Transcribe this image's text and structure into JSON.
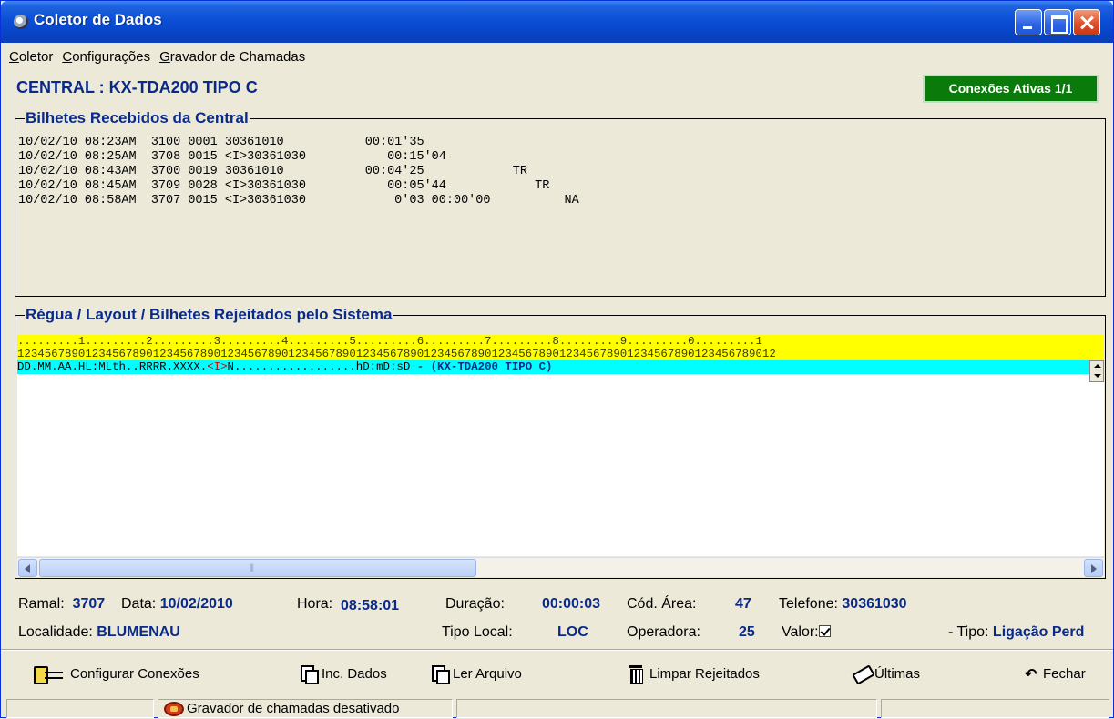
{
  "window": {
    "title": "Coletor de Dados"
  },
  "menu": [
    {
      "accel": "C",
      "rest": "oletor"
    },
    {
      "accel": "C",
      "rest": "onfigurações"
    },
    {
      "accel": "G",
      "rest": "ravador de Chamadas"
    }
  ],
  "central": {
    "label": "CENTRAL : KX-TDA200 TIPO C"
  },
  "connections_badge": "Conexões Ativas 1/1",
  "received": {
    "title": "Bilhetes Recebidos da Central",
    "lines": [
      "10/02/10 08:23AM  3100 0001 30361010           00:01'35",
      "10/02/10 08:25AM  3708 0015 <I>30361030           00:15'04",
      "10/02/10 08:43AM  3700 0019 30361010           00:04'25            TR",
      "10/02/10 08:45AM  3709 0028 <I>30361030           00:05'44            TR",
      "10/02/10 08:58AM  3707 0015 <I>30361030            0'03 00:00'00          NA"
    ]
  },
  "ruler": {
    "title": "Régua / Layout / Bilhetes Rejeitados pelo Sistema",
    "line1": ".........1.........2.........3.........4.........5.........6.........7.........8.........9.........0.........1",
    "line2": "1234567890123456789012345678901234567890123456789012345678901234567890123456789012345678901234567890123456789012",
    "layout_a": "DD.MM.AA.HL:MLth..RRRR.XXXX.",
    "layout_red": "<I>",
    "layout_b": "N..................hD:mD:sD - ",
    "layout_blue": "(KX-TDA200 TIPO C)"
  },
  "details": {
    "ramal_label": "Ramal:",
    "ramal": "3707",
    "data_label": "Data:",
    "data": "10/02/2010",
    "hora_label": "Hora:",
    "hora": "08:58:01",
    "duracao_label": "Duração:",
    "duracao": "00:00:03",
    "area_label": "Cód. Área:",
    "area": "47",
    "telefone_label": "Telefone:",
    "telefone": "30361030",
    "localidade_label": "Localidade:",
    "localidade": "BLUMENAU",
    "tipo_local_label": "Tipo Local:",
    "tipo_local": "LOC",
    "operadora_label": "Operadora:",
    "operadora": "25",
    "valor_label": "Valor:",
    "tipo_label": "- Tipo:",
    "tipo": "Ligação Perd"
  },
  "toolbar": {
    "configurar": "Configurar Conexões",
    "inc_dados": "Inc. Dados",
    "ler_arquivo": "Ler Arquivo",
    "limpar": "Limpar Rejeitados",
    "ultimas": "Últimas",
    "fechar": "Fechar"
  },
  "status": {
    "recorder": "Gravador de chamadas desativado"
  }
}
